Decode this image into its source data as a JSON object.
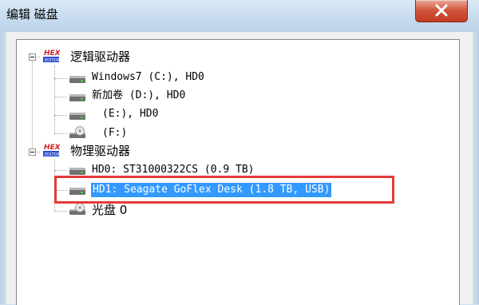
{
  "window": {
    "title": "编辑 磁盘"
  },
  "tree": {
    "logical_group": "逻辑驱动器",
    "logical_drives": [
      "Windows7 (C:), HD0",
      "新加卷 (D:), HD0",
      "(E:), HD0",
      "(F:)"
    ],
    "physical_group": "物理驱动器",
    "physical_drives": [
      "HD0: ST31000322CS (0.9 TB)",
      "HD1: Seagate GoFlex Desk (1.8 TB, USB)",
      "光盘 0"
    ]
  },
  "colors": {
    "selection": "#3399ff",
    "highlight": "#e53a3a",
    "close": "#c33c22"
  },
  "icons": {
    "group": "hex-logo-icon",
    "drive": "hard-drive-icon",
    "optical": "optical-drive-icon"
  }
}
